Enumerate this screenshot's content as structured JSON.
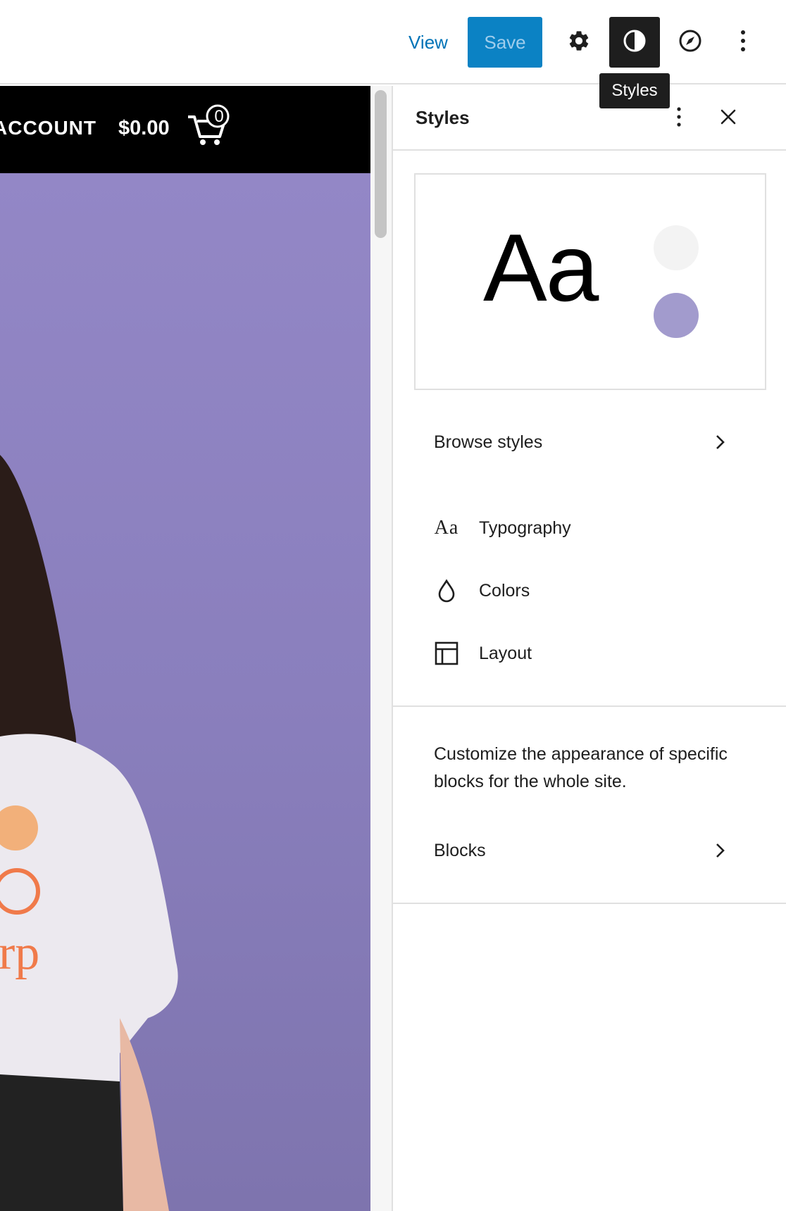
{
  "toolbar": {
    "view_label": "View",
    "save_label": "Save",
    "tooltip": "Styles",
    "icons": [
      "gear-icon",
      "contrast-icon",
      "compass-icon",
      "more-vertical-icon"
    ]
  },
  "site": {
    "account_text": "ACCOUNT",
    "cart_amount": "$0.00",
    "cart_count": "0",
    "hero_color": "#9387c4"
  },
  "sidebar": {
    "title": "Styles",
    "preview": {
      "sample_text": "Aa",
      "swatches": [
        "#f3f3f3",
        "#a29bcd"
      ]
    },
    "browse_styles": "Browse styles",
    "items": [
      {
        "label": "Typography",
        "icon": "typography-icon"
      },
      {
        "label": "Colors",
        "icon": "droplet-icon"
      },
      {
        "label": "Layout",
        "icon": "layout-icon"
      }
    ],
    "blocks_description": "Customize the appearance of specific blocks for the whole site.",
    "blocks_label": "Blocks"
  },
  "colors": {
    "accent": "#0b82c4",
    "link": "#0073b7",
    "dark": "#1e1e1e"
  }
}
